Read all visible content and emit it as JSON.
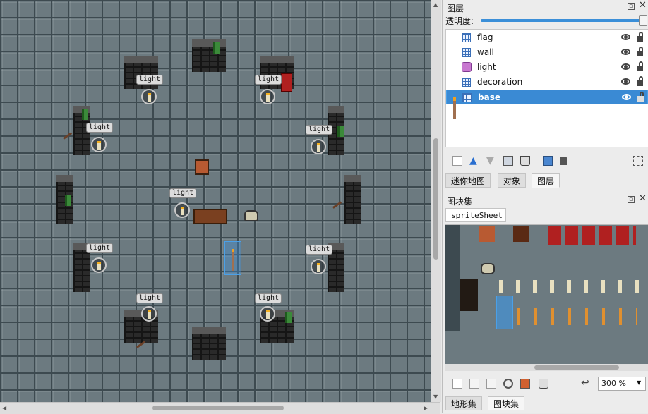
{
  "map": {
    "light_tag": "light"
  },
  "layers_panel": {
    "title": "图层",
    "opacity_label": "透明度:",
    "opacity_value": 1.0,
    "layers": [
      {
        "name": "flag",
        "type": "tile",
        "visible": true,
        "locked": false,
        "selected": false
      },
      {
        "name": "wall",
        "type": "tile",
        "visible": true,
        "locked": false,
        "selected": false
      },
      {
        "name": "light",
        "type": "object",
        "visible": true,
        "locked": false,
        "selected": false
      },
      {
        "name": "decoration",
        "type": "tile",
        "visible": true,
        "locked": false,
        "selected": false
      },
      {
        "name": "base",
        "type": "tile",
        "visible": true,
        "locked": false,
        "selected": true
      }
    ],
    "tabs": [
      "迷你地图",
      "对象",
      "图层"
    ],
    "active_tab": "图层"
  },
  "tileset_panel": {
    "title": "图块集",
    "tileset_tab": "spriteSheet",
    "zoom": "300 %",
    "tabs": [
      "地形集",
      "图块集"
    ],
    "active_tab": "图块集"
  },
  "colors": {
    "selection": "#3a8ad4",
    "floor": "#6c7a80",
    "wall": "#2a2a2a"
  }
}
